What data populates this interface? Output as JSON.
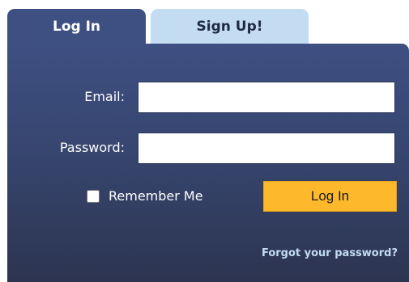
{
  "tabs": {
    "login": "Log In",
    "signup": "Sign Up!"
  },
  "form": {
    "email_label": "Email:",
    "email_value": "",
    "password_label": "Password:",
    "password_value": "",
    "remember_label": "Remember Me",
    "remember_checked": false,
    "submit_label": "Log In",
    "forgot_link": "Forgot your password?"
  },
  "colors": {
    "panel": "#3e4f82",
    "panel_bottom": "#2c3450",
    "inactive_tab": "#c4dcf2",
    "button": "#fdb82c"
  }
}
